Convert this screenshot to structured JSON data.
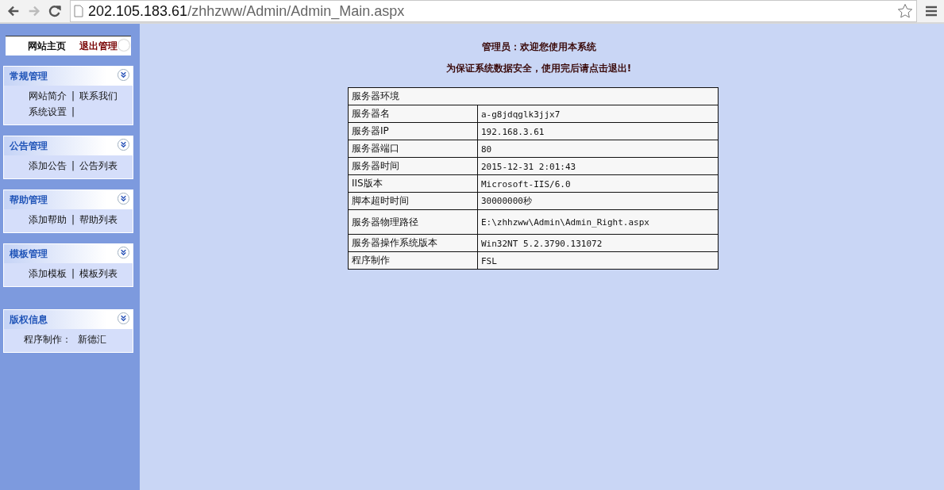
{
  "browser": {
    "url_host": "202.105.183.61",
    "url_path": "/zhhzww/Admin/Admin_Main.aspx",
    "forward_disabled": true
  },
  "top_links": [
    "网站主页",
    "退出管理"
  ],
  "sidebar": [
    {
      "title": "常规管理",
      "lines": [
        [
          {
            "kind": "link",
            "text": "网站简介"
          },
          {
            "kind": "sep",
            "text": "|"
          },
          {
            "kind": "link",
            "text": "联系我们"
          }
        ],
        [
          {
            "kind": "link",
            "text": "系统设置"
          },
          {
            "kind": "sep",
            "text": "|"
          }
        ]
      ]
    },
    {
      "title": "公告管理",
      "lines": [
        [
          {
            "kind": "link",
            "text": "添加公告"
          },
          {
            "kind": "sep",
            "text": "|"
          },
          {
            "kind": "link",
            "text": "公告列表"
          }
        ]
      ]
    },
    {
      "title": "帮助管理",
      "lines": [
        [
          {
            "kind": "link",
            "text": "添加帮助"
          },
          {
            "kind": "sep",
            "text": "|"
          },
          {
            "kind": "link",
            "text": "帮助列表"
          }
        ]
      ]
    },
    {
      "title": "模板管理",
      "lines": [
        [
          {
            "kind": "link",
            "text": "添加模板"
          },
          {
            "kind": "sep",
            "text": "|"
          },
          {
            "kind": "link",
            "text": "模板列表"
          }
        ]
      ]
    },
    {
      "title": "版权信息",
      "lines": [
        [
          {
            "kind": "text",
            "text": "程序制作："
          },
          {
            "kind": "text",
            "text": "新德汇"
          }
        ]
      ]
    }
  ],
  "welcome": [
    "管理员：欢迎您使用本系统",
    "为保证系统数据安全，使用完后请点击退出!"
  ],
  "table": {
    "title": "服务器环境",
    "rows": [
      {
        "label": "服务器名",
        "value": "a-g8jdqglk3jjx7"
      },
      {
        "label": "服务器IP",
        "value": "192.168.3.61"
      },
      {
        "label": "服务器端口",
        "value": "80"
      },
      {
        "label": "服务器时间",
        "value": "2015-12-31 2:01:43"
      },
      {
        "label": "IIS版本",
        "value": "Microsoft-IIS/6.0"
      },
      {
        "label": "脚本超时时间",
        "value": "30000000秒"
      },
      {
        "label": "服务器物理路径",
        "value": "E:\\zhhzww\\Admin\\Admin_Right.aspx"
      },
      {
        "label": "服务器操作系统版本",
        "value": "Win32NT 5.2.3790.131072"
      },
      {
        "label": "程序制作",
        "value": "FSL"
      }
    ]
  }
}
